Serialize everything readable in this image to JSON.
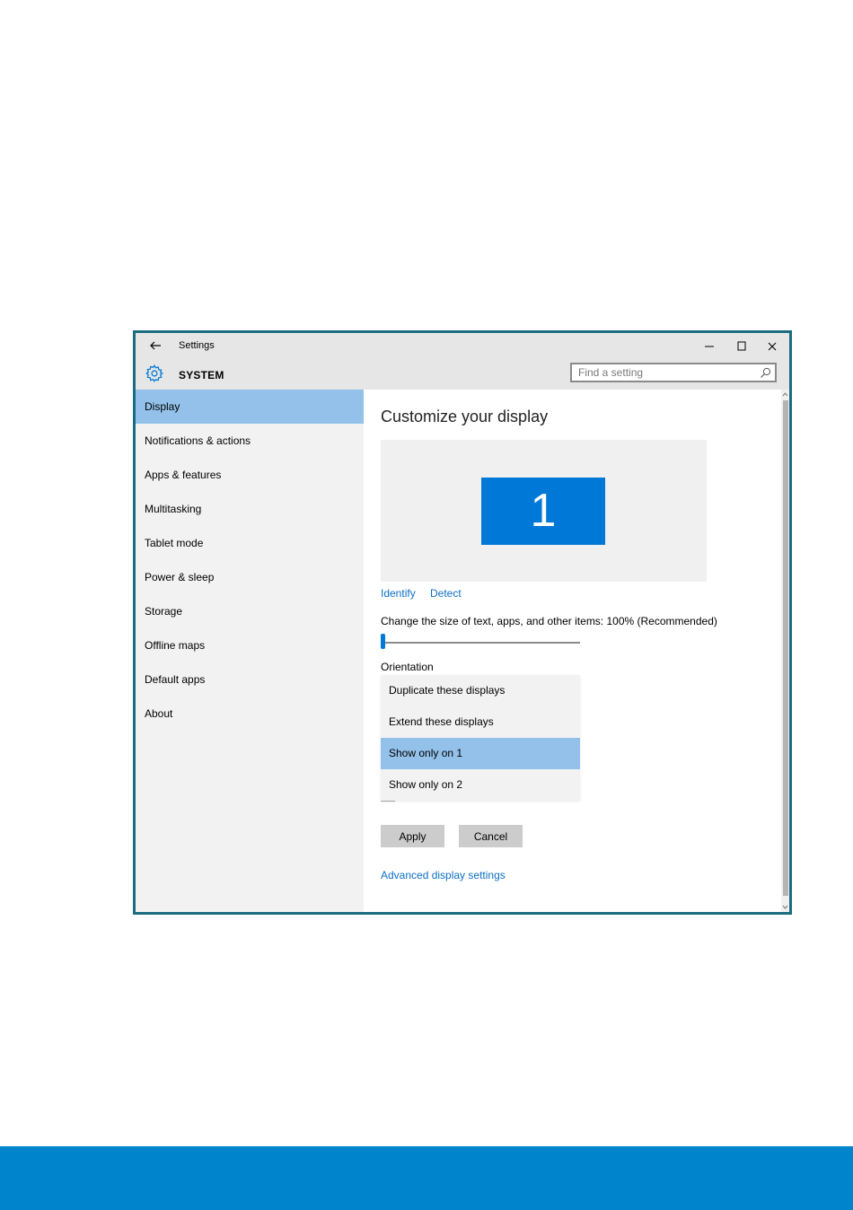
{
  "window": {
    "title": "Settings",
    "section": "SYSTEM",
    "search_placeholder": "Find a setting"
  },
  "sidebar": {
    "items": [
      {
        "label": "Display",
        "active": true
      },
      {
        "label": "Notifications & actions"
      },
      {
        "label": "Apps & features"
      },
      {
        "label": "Multitasking"
      },
      {
        "label": "Tablet mode"
      },
      {
        "label": "Power & sleep"
      },
      {
        "label": "Storage"
      },
      {
        "label": "Offline maps"
      },
      {
        "label": "Default apps"
      },
      {
        "label": "About"
      }
    ]
  },
  "main": {
    "title": "Customize your display",
    "monitor_number": "1",
    "identify_link": "Identify",
    "detect_link": "Detect",
    "size_label": "Change the size of text, apps, and other items: 100% (Recommended)",
    "slider_value_percent": 0,
    "orientation_label": "Orientation",
    "dropdown": {
      "options": [
        "Duplicate these displays",
        "Extend these displays",
        "Show only on 1",
        "Show only on 2"
      ],
      "selected_index": 2
    },
    "apply_label": "Apply",
    "cancel_label": "Cancel",
    "advanced_link": "Advanced display settings"
  },
  "colors": {
    "accent": "#0078d7",
    "selection": "#93c1ea",
    "link": "#0e6fc4",
    "window_border": "#1b6c80",
    "footer_band": "#0085cc"
  },
  "icons": [
    "back-arrow-icon",
    "minimize-icon",
    "maximize-icon",
    "close-icon",
    "gear-icon",
    "search-icon"
  ]
}
